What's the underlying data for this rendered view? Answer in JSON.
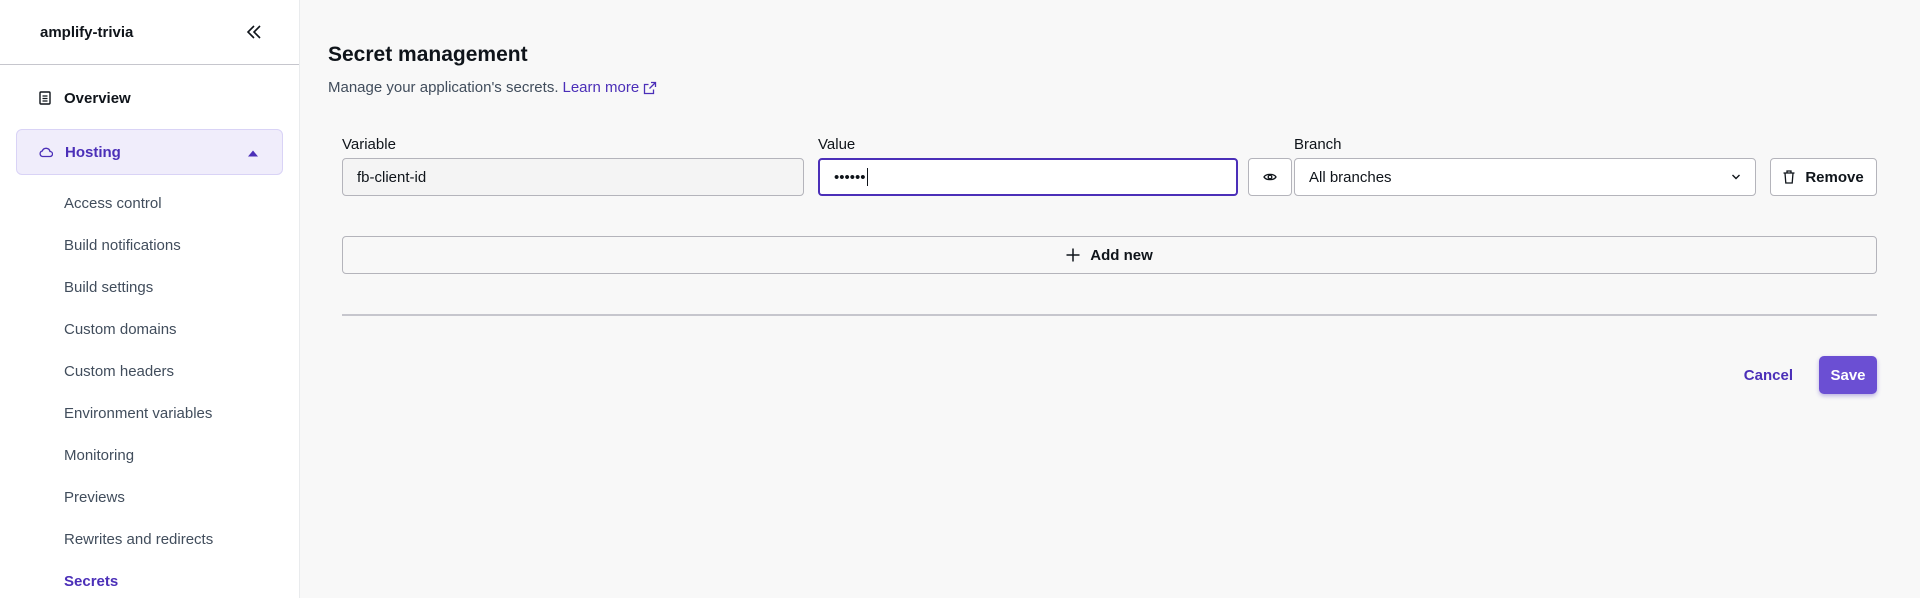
{
  "sidebar": {
    "app_name": "amplify-trivia",
    "overview_label": "Overview",
    "hosting_label": "Hosting",
    "items": [
      {
        "label": "Access control"
      },
      {
        "label": "Build notifications"
      },
      {
        "label": "Build settings"
      },
      {
        "label": "Custom domains"
      },
      {
        "label": "Custom headers"
      },
      {
        "label": "Environment variables"
      },
      {
        "label": "Monitoring"
      },
      {
        "label": "Previews"
      },
      {
        "label": "Rewrites and redirects"
      },
      {
        "label": "Secrets"
      }
    ],
    "current_item": "Secrets"
  },
  "main": {
    "title": "Secret management",
    "description": "Manage your application's secrets.",
    "learn_more": "Learn more",
    "form": {
      "variable_label": "Variable",
      "value_label": "Value",
      "branch_label": "Branch",
      "variable_value": "fb-client-id",
      "value_masked": "••••••",
      "branch_value": "All branches",
      "remove_label": "Remove",
      "add_new_label": "Add new"
    },
    "cancel_label": "Cancel",
    "save_label": "Save"
  },
  "colors": {
    "accent": "#4b2fb8",
    "primary_button": "#6b4fd3",
    "active_nav_bg": "#f0edfb"
  },
  "icons": {
    "collapse": "double-chevron-left-icon",
    "overview": "document-icon",
    "hosting": "cloud-icon",
    "expand": "caret-up-icon",
    "external": "external-link-icon",
    "reveal": "eye-icon",
    "dropdown": "chevron-down-icon",
    "remove": "trash-icon",
    "add": "plus-icon"
  }
}
